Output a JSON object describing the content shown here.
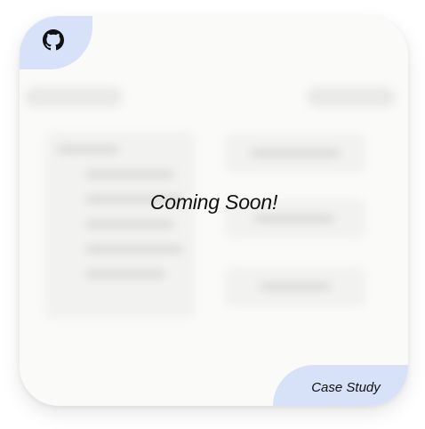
{
  "card": {
    "overlay_text": "Coming Soon!",
    "github_icon": "github-icon",
    "case_study_label": "Case Study",
    "accent_color": "#d7e1f7",
    "background_color": "#fafaf9"
  }
}
